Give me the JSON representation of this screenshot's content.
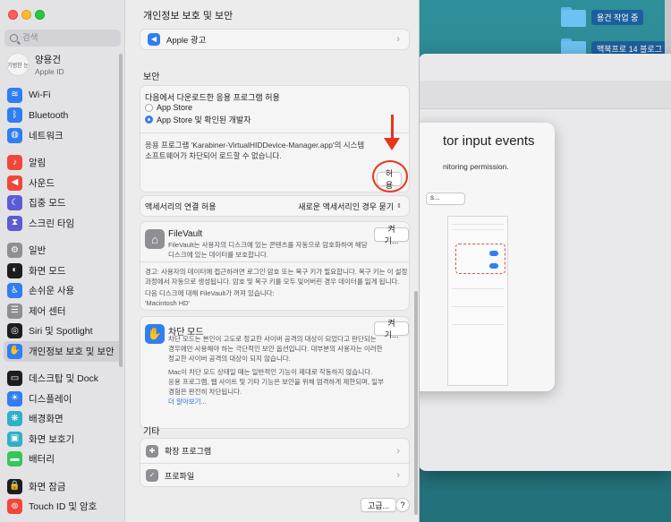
{
  "desktop": {
    "folders": [
      {
        "label": "용건 작업 중"
      },
      {
        "label": "맥북프로 14 블로그"
      }
    ]
  },
  "background_dialog": {
    "title": "tor input events",
    "subtitle": "nitoring permission.",
    "button": "s..."
  },
  "sidebar": {
    "search_placeholder": "검색",
    "account": {
      "name": "양용건",
      "subtitle": "Apple ID",
      "avatar_text": "기범한 눈"
    },
    "groups": [
      [
        {
          "label": "Wi-Fi",
          "icon": "wifi-icon",
          "color": "#2f7ef3",
          "glyph": "≋"
        },
        {
          "label": "Bluetooth",
          "icon": "bluetooth-icon",
          "color": "#2f7ef3",
          "glyph": "ᛒ"
        },
        {
          "label": "네트워크",
          "icon": "globe-icon",
          "color": "#2f7ef3",
          "glyph": "◍"
        }
      ],
      [
        {
          "label": "알림",
          "icon": "bell-icon",
          "color": "#f0473b",
          "glyph": "♪"
        },
        {
          "label": "사운드",
          "icon": "speaker-icon",
          "color": "#f0473b",
          "glyph": "◀"
        },
        {
          "label": "집중 모드",
          "icon": "moon-icon",
          "color": "#5b5bd6",
          "glyph": "☾"
        },
        {
          "label": "스크린 타임",
          "icon": "hourglass-icon",
          "color": "#5b5bd6",
          "glyph": "⧗"
        }
      ],
      [
        {
          "label": "일반",
          "icon": "gear-icon",
          "color": "#8e8e93",
          "glyph": "⚙"
        },
        {
          "label": "화면 모드",
          "icon": "appearance-icon",
          "color": "#1d1d1f",
          "glyph": "◐"
        },
        {
          "label": "손쉬운 사용",
          "icon": "accessibility-icon",
          "color": "#2f7ef3",
          "glyph": "♿"
        },
        {
          "label": "제어 센터",
          "icon": "control-center-icon",
          "color": "#8e8e93",
          "glyph": "☰"
        },
        {
          "label": "Siri 및 Spotlight",
          "icon": "siri-icon",
          "color": "#1d1d1f",
          "glyph": "◎"
        },
        {
          "label": "개인정보 보호 및 보안",
          "icon": "hand-icon",
          "color": "#2f7ef3",
          "glyph": "✋",
          "active": true
        }
      ],
      [
        {
          "label": "데스크탑 및 Dock",
          "icon": "dock-icon",
          "color": "#1d1d1f",
          "glyph": "▭"
        },
        {
          "label": "디스플레이",
          "icon": "display-icon",
          "color": "#2f7ef3",
          "glyph": "☀"
        },
        {
          "label": "배경화면",
          "icon": "wallpaper-icon",
          "color": "#30b0c7",
          "glyph": "❋"
        },
        {
          "label": "화면 보호기",
          "icon": "screensaver-icon",
          "color": "#30b0c7",
          "glyph": "▣"
        },
        {
          "label": "배터리",
          "icon": "battery-icon",
          "color": "#34c759",
          "glyph": "▬"
        }
      ],
      [
        {
          "label": "화면 잠금",
          "icon": "lock-icon",
          "color": "#1d1d1f",
          "glyph": "🔒"
        },
        {
          "label": "Touch ID 및 암호",
          "icon": "fingerprint-icon",
          "color": "#f0473b",
          "glyph": "⊚"
        }
      ]
    ]
  },
  "content": {
    "title": "개인정보 보호 및 보안",
    "apple_ads": "Apple 광고",
    "security_header": "보안",
    "allow_download_label": "다음에서 다운로드한 응용 프로그램 허용",
    "radio_options": [
      {
        "label": "App Store",
        "selected": false
      },
      {
        "label": "App Store 및 확인된 개발자",
        "selected": true
      }
    ],
    "blocked_message_line1": "응용 프로그램 'Karabiner-VirtualHIDDevice-Manager.app'의 시스템",
    "blocked_message_line2": "소프트웨어가 차단되어 로드할 수 없습니다.",
    "allow_button": "허용",
    "accessory_label": "액세서리의 연결 허용",
    "accessory_value": "새로운 액세서리인 경우 묻기",
    "filevault_title": "FileVault",
    "filevault_button": "켜기...",
    "filevault_desc1": "FileVault는 사용자의 디스크에 있는 콘텐츠를 자동으로 암호화하여 해당",
    "filevault_desc2": "디스크에 있는 데이터를 보호합니다.",
    "filevault_warn1": "경고: 사용자의 데이터에 접근하려면 로그인 암호 또는 복구 키가 필요합니다. 복구 키는 이 설정",
    "filevault_warn2": "과정에서 자동으로 생성됩니다. 암호 및 복구 키를 모두 잊어버린 경우 데이터를 잃게 됩니다.",
    "filevault_off1": "다음 디스크에 대해 FileVault가 꺼져 있습니다:",
    "filevault_off2": "'Macintosh HD'",
    "lockdown_title": "차단 모드",
    "lockdown_button": "켜기...",
    "lockdown_desc1": "차단 모드는 본인이 고도로 정교한 사이버 공격의 대상이 되었다고 판단되는",
    "lockdown_desc2": "경우에만 사용해야 하는 극단적인 보안 옵션입니다. 대부분의 사용자는 이러한",
    "lockdown_desc3": "정교한 사이버 공격의 대상이 되지 않습니다.",
    "lockdown_desc4": "Mac이 차단 모드 상태일 때는 일반적인 기능이 제대로 작동하지 않습니다.",
    "lockdown_desc5": "응용 프로그램, 웹 사이트 및 기타 기능은 보안을 위해 엄격하게 제한되며, 일부",
    "lockdown_desc6": "경험은 완전히 차단됩니다.",
    "lockdown_link": "더 알아보기...",
    "others_header": "기타",
    "extensions": "확장 프로그램",
    "profiles": "프로파일",
    "advanced_button": "고급...",
    "help_button": "?"
  }
}
